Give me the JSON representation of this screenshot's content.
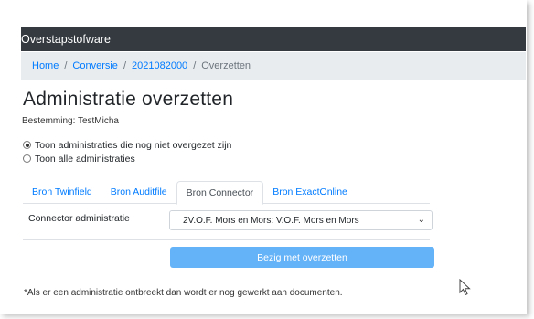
{
  "navbar": {
    "brand": "Overstapstofware"
  },
  "breadcrumb": {
    "items": [
      "Home",
      "Conversie",
      "2021082000"
    ],
    "active": "Overzetten"
  },
  "page": {
    "title": "Administratie overzetten",
    "bestemming": "Bestemming: TestMicha"
  },
  "radios": {
    "option1": "Toon administraties die nog niet overgezet zijn",
    "option2": "Toon alle administraties",
    "selected": "option1"
  },
  "tabs": [
    {
      "label": "Bron Twinfield",
      "active": false
    },
    {
      "label": "Bron Auditfile",
      "active": false
    },
    {
      "label": "Bron Connector",
      "active": true
    },
    {
      "label": "Bron ExactOnline",
      "active": false
    }
  ],
  "form": {
    "label": "Connector administratie",
    "selected_value": "2V.O.F. Mors en Mors: V.O.F. Mors en Mors"
  },
  "submit": {
    "label": "Bezig met overzetten"
  },
  "note": "*Als er een administratie ontbreekt dan wordt er nog gewerkt aan documenten.",
  "colors": {
    "navbar": "#343a40",
    "link": "#007bff",
    "button": "#64b2f7"
  }
}
